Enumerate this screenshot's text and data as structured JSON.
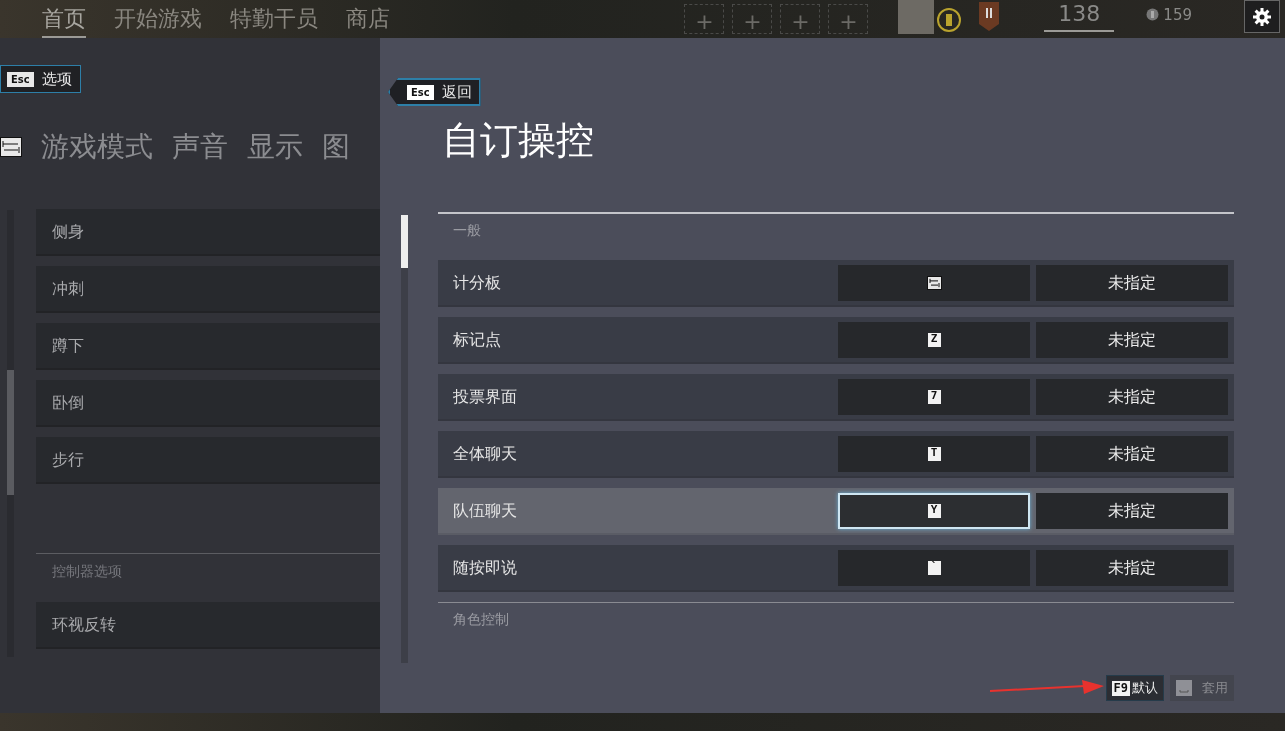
{
  "top_nav": {
    "items": [
      {
        "label": "首页",
        "selected": true
      },
      {
        "label": "开始游戏",
        "selected": false
      },
      {
        "label": "特勤干员",
        "selected": false
      },
      {
        "label": "商店",
        "selected": false
      }
    ],
    "slots": [
      "+",
      "+",
      "+",
      "+"
    ],
    "level": "138",
    "credits": "159"
  },
  "options_panel": {
    "back_button": {
      "key": "Esc",
      "label": "选项"
    },
    "tabs": [
      {
        "label": "游戏模式"
      },
      {
        "label": "声音"
      },
      {
        "label": "显示"
      },
      {
        "label": "图"
      }
    ],
    "items": [
      "侧身",
      "冲刺",
      "蹲下",
      "卧倒",
      "步行"
    ],
    "controller_section": {
      "title": "控制器选项",
      "items": [
        "环视反转"
      ]
    }
  },
  "controls_panel": {
    "back_button": {
      "key": "Esc",
      "label": "返回"
    },
    "title": "自订操控",
    "sections": [
      {
        "title": "一般",
        "rows": [
          {
            "action": "计分板",
            "key": {
              "kind": "icon"
            },
            "alternate": "未指定",
            "selected": false
          },
          {
            "action": "标记点",
            "key": {
              "kind": "glyph",
              "text": "Z"
            },
            "alternate": "未指定",
            "selected": false
          },
          {
            "action": "投票界面",
            "key": {
              "kind": "glyph",
              "text": "7"
            },
            "alternate": "未指定",
            "selected": false
          },
          {
            "action": "全体聊天",
            "key": {
              "kind": "glyph",
              "text": "T"
            },
            "alternate": "未指定",
            "selected": false
          },
          {
            "action": "队伍聊天",
            "key": {
              "kind": "glyph",
              "text": "Y"
            },
            "alternate": "未指定",
            "selected": true
          },
          {
            "action": "随按即说",
            "key": {
              "kind": "glyph",
              "text": "`"
            },
            "alternate": "未指定",
            "selected": false
          }
        ]
      },
      {
        "title": "角色控制"
      }
    ],
    "footer_buttons": [
      {
        "key": {
          "kind": "glyph",
          "text": "F9"
        },
        "label": "默认",
        "disabled": false
      },
      {
        "key": {
          "kind": "icon"
        },
        "label": "套用",
        "disabled": true
      }
    ]
  }
}
